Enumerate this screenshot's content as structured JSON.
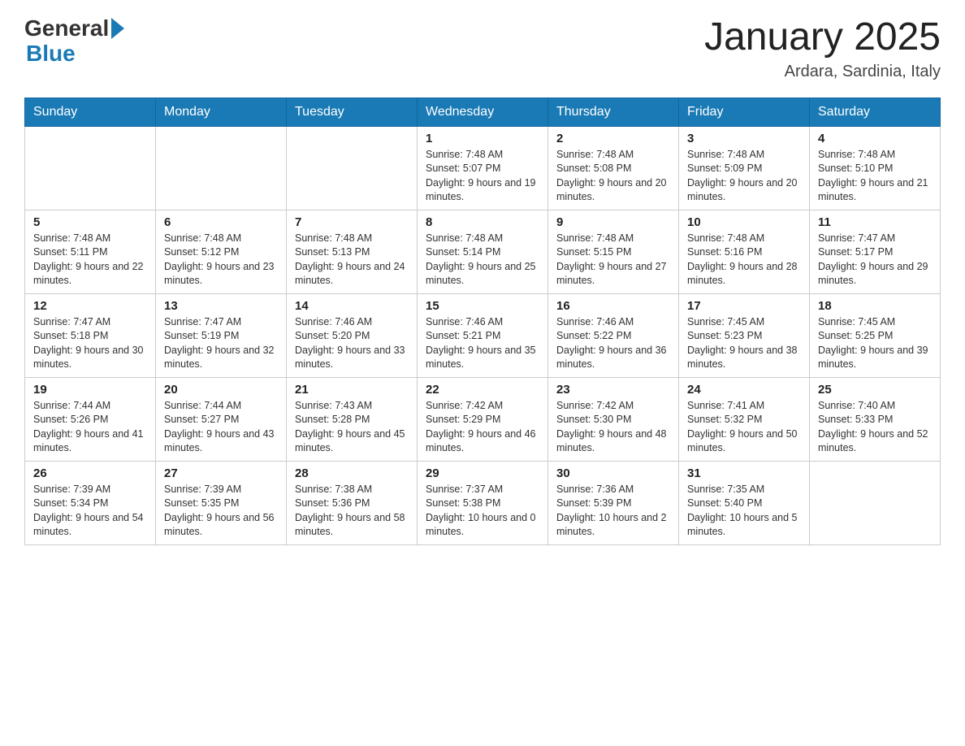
{
  "header": {
    "logo_general": "General",
    "logo_blue": "Blue",
    "title": "January 2025",
    "subtitle": "Ardara, Sardinia, Italy"
  },
  "weekdays": [
    "Sunday",
    "Monday",
    "Tuesday",
    "Wednesday",
    "Thursday",
    "Friday",
    "Saturday"
  ],
  "weeks": [
    [
      {
        "day": "",
        "sunrise": "",
        "sunset": "",
        "daylight": ""
      },
      {
        "day": "",
        "sunrise": "",
        "sunset": "",
        "daylight": ""
      },
      {
        "day": "",
        "sunrise": "",
        "sunset": "",
        "daylight": ""
      },
      {
        "day": "1",
        "sunrise": "Sunrise: 7:48 AM",
        "sunset": "Sunset: 5:07 PM",
        "daylight": "Daylight: 9 hours and 19 minutes."
      },
      {
        "day": "2",
        "sunrise": "Sunrise: 7:48 AM",
        "sunset": "Sunset: 5:08 PM",
        "daylight": "Daylight: 9 hours and 20 minutes."
      },
      {
        "day": "3",
        "sunrise": "Sunrise: 7:48 AM",
        "sunset": "Sunset: 5:09 PM",
        "daylight": "Daylight: 9 hours and 20 minutes."
      },
      {
        "day": "4",
        "sunrise": "Sunrise: 7:48 AM",
        "sunset": "Sunset: 5:10 PM",
        "daylight": "Daylight: 9 hours and 21 minutes."
      }
    ],
    [
      {
        "day": "5",
        "sunrise": "Sunrise: 7:48 AM",
        "sunset": "Sunset: 5:11 PM",
        "daylight": "Daylight: 9 hours and 22 minutes."
      },
      {
        "day": "6",
        "sunrise": "Sunrise: 7:48 AM",
        "sunset": "Sunset: 5:12 PM",
        "daylight": "Daylight: 9 hours and 23 minutes."
      },
      {
        "day": "7",
        "sunrise": "Sunrise: 7:48 AM",
        "sunset": "Sunset: 5:13 PM",
        "daylight": "Daylight: 9 hours and 24 minutes."
      },
      {
        "day": "8",
        "sunrise": "Sunrise: 7:48 AM",
        "sunset": "Sunset: 5:14 PM",
        "daylight": "Daylight: 9 hours and 25 minutes."
      },
      {
        "day": "9",
        "sunrise": "Sunrise: 7:48 AM",
        "sunset": "Sunset: 5:15 PM",
        "daylight": "Daylight: 9 hours and 27 minutes."
      },
      {
        "day": "10",
        "sunrise": "Sunrise: 7:48 AM",
        "sunset": "Sunset: 5:16 PM",
        "daylight": "Daylight: 9 hours and 28 minutes."
      },
      {
        "day": "11",
        "sunrise": "Sunrise: 7:47 AM",
        "sunset": "Sunset: 5:17 PM",
        "daylight": "Daylight: 9 hours and 29 minutes."
      }
    ],
    [
      {
        "day": "12",
        "sunrise": "Sunrise: 7:47 AM",
        "sunset": "Sunset: 5:18 PM",
        "daylight": "Daylight: 9 hours and 30 minutes."
      },
      {
        "day": "13",
        "sunrise": "Sunrise: 7:47 AM",
        "sunset": "Sunset: 5:19 PM",
        "daylight": "Daylight: 9 hours and 32 minutes."
      },
      {
        "day": "14",
        "sunrise": "Sunrise: 7:46 AM",
        "sunset": "Sunset: 5:20 PM",
        "daylight": "Daylight: 9 hours and 33 minutes."
      },
      {
        "day": "15",
        "sunrise": "Sunrise: 7:46 AM",
        "sunset": "Sunset: 5:21 PM",
        "daylight": "Daylight: 9 hours and 35 minutes."
      },
      {
        "day": "16",
        "sunrise": "Sunrise: 7:46 AM",
        "sunset": "Sunset: 5:22 PM",
        "daylight": "Daylight: 9 hours and 36 minutes."
      },
      {
        "day": "17",
        "sunrise": "Sunrise: 7:45 AM",
        "sunset": "Sunset: 5:23 PM",
        "daylight": "Daylight: 9 hours and 38 minutes."
      },
      {
        "day": "18",
        "sunrise": "Sunrise: 7:45 AM",
        "sunset": "Sunset: 5:25 PM",
        "daylight": "Daylight: 9 hours and 39 minutes."
      }
    ],
    [
      {
        "day": "19",
        "sunrise": "Sunrise: 7:44 AM",
        "sunset": "Sunset: 5:26 PM",
        "daylight": "Daylight: 9 hours and 41 minutes."
      },
      {
        "day": "20",
        "sunrise": "Sunrise: 7:44 AM",
        "sunset": "Sunset: 5:27 PM",
        "daylight": "Daylight: 9 hours and 43 minutes."
      },
      {
        "day": "21",
        "sunrise": "Sunrise: 7:43 AM",
        "sunset": "Sunset: 5:28 PM",
        "daylight": "Daylight: 9 hours and 45 minutes."
      },
      {
        "day": "22",
        "sunrise": "Sunrise: 7:42 AM",
        "sunset": "Sunset: 5:29 PM",
        "daylight": "Daylight: 9 hours and 46 minutes."
      },
      {
        "day": "23",
        "sunrise": "Sunrise: 7:42 AM",
        "sunset": "Sunset: 5:30 PM",
        "daylight": "Daylight: 9 hours and 48 minutes."
      },
      {
        "day": "24",
        "sunrise": "Sunrise: 7:41 AM",
        "sunset": "Sunset: 5:32 PM",
        "daylight": "Daylight: 9 hours and 50 minutes."
      },
      {
        "day": "25",
        "sunrise": "Sunrise: 7:40 AM",
        "sunset": "Sunset: 5:33 PM",
        "daylight": "Daylight: 9 hours and 52 minutes."
      }
    ],
    [
      {
        "day": "26",
        "sunrise": "Sunrise: 7:39 AM",
        "sunset": "Sunset: 5:34 PM",
        "daylight": "Daylight: 9 hours and 54 minutes."
      },
      {
        "day": "27",
        "sunrise": "Sunrise: 7:39 AM",
        "sunset": "Sunset: 5:35 PM",
        "daylight": "Daylight: 9 hours and 56 minutes."
      },
      {
        "day": "28",
        "sunrise": "Sunrise: 7:38 AM",
        "sunset": "Sunset: 5:36 PM",
        "daylight": "Daylight: 9 hours and 58 minutes."
      },
      {
        "day": "29",
        "sunrise": "Sunrise: 7:37 AM",
        "sunset": "Sunset: 5:38 PM",
        "daylight": "Daylight: 10 hours and 0 minutes."
      },
      {
        "day": "30",
        "sunrise": "Sunrise: 7:36 AM",
        "sunset": "Sunset: 5:39 PM",
        "daylight": "Daylight: 10 hours and 2 minutes."
      },
      {
        "day": "31",
        "sunrise": "Sunrise: 7:35 AM",
        "sunset": "Sunset: 5:40 PM",
        "daylight": "Daylight: 10 hours and 5 minutes."
      },
      {
        "day": "",
        "sunrise": "",
        "sunset": "",
        "daylight": ""
      }
    ]
  ]
}
